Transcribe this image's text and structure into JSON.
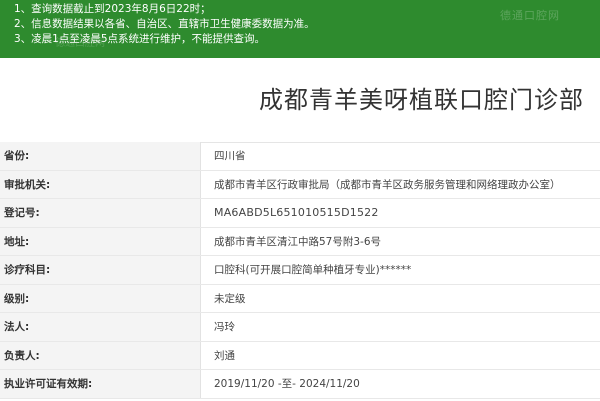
{
  "notice": {
    "lines": [
      "1、查询数据截止到2023年8月6日22时；",
      "2、信息数据结果以各省、自治区、直辖市卫生健康委数据为准。",
      "3、凌晨1点至凌晨5点系统进行维护，不能提供查询。"
    ],
    "watermark": "德通口腔网",
    "watermark2": "德通口腔网"
  },
  "page_title": "成都青羊美呀植联口腔门诊部",
  "rows": [
    {
      "label": "省份:",
      "value": "四川省"
    },
    {
      "label": "审批机关:",
      "value": "成都市青羊区行政审批局（成都市青羊区政务服务管理和网络理政办公室）"
    },
    {
      "label": "登记号:",
      "value": "MA6ABD5L651010515D1522"
    },
    {
      "label": "地址:",
      "value": "成都市青羊区清江中路57号附3-6号"
    },
    {
      "label": "诊疗科目:",
      "value": "口腔科(可开展口腔简单种植牙专业)******"
    },
    {
      "label": "级别:",
      "value": "未定级"
    },
    {
      "label": "法人:",
      "value": "冯玲"
    },
    {
      "label": "负责人:",
      "value": "刘通"
    },
    {
      "label": "执业许可证有效期:",
      "value": "2019/11/20 -至- 2024/11/20"
    }
  ],
  "colors": {
    "notice_bg": "#2e8b2e",
    "label_bg": "#f4f4f4"
  }
}
